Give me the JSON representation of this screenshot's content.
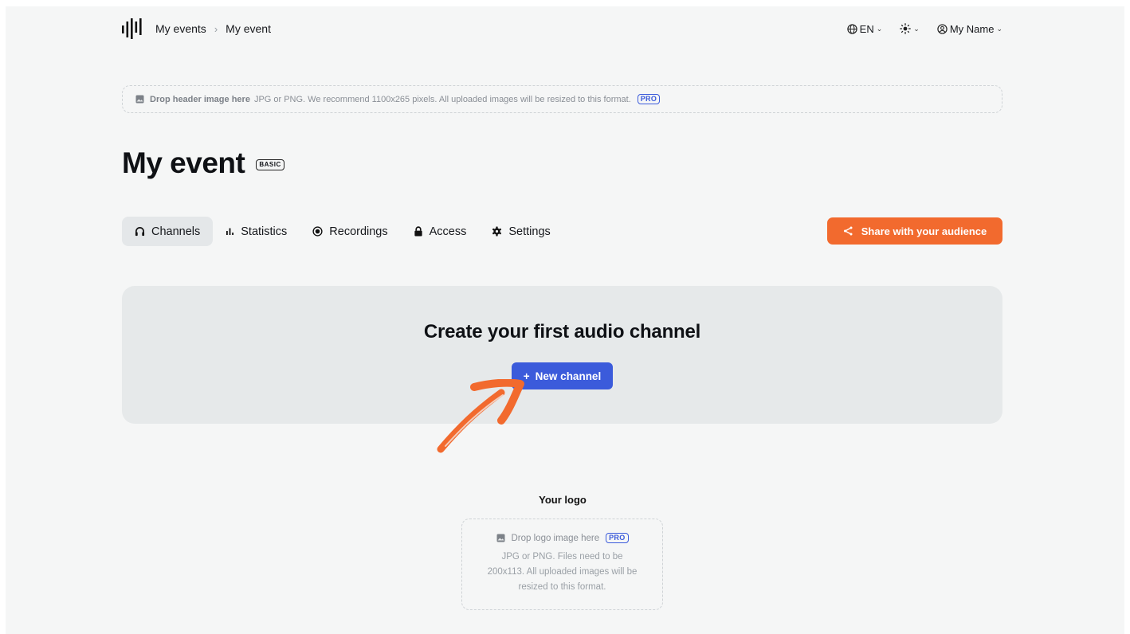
{
  "breadcrumb": {
    "home": "My events",
    "separator": "›",
    "current": "My event"
  },
  "topbar": {
    "language": "EN",
    "user": "My Name"
  },
  "header_drop": {
    "strong": "Drop header image here",
    "hint": "JPG or PNG. We recommend 1100x265 pixels. All uploaded images will be resized to this format.",
    "badge": "PRO"
  },
  "page": {
    "title": "My event",
    "badge": "BASIC"
  },
  "tabs": [
    {
      "label": "Channels",
      "icon": "headphones-icon",
      "active": true
    },
    {
      "label": "Statistics",
      "icon": "bar-chart-icon",
      "active": false
    },
    {
      "label": "Recordings",
      "icon": "record-icon",
      "active": false
    },
    {
      "label": "Access",
      "icon": "lock-icon",
      "active": false
    },
    {
      "label": "Settings",
      "icon": "gear-icon",
      "active": false
    }
  ],
  "share": {
    "label": "Share with your audience"
  },
  "create_panel": {
    "title": "Create your first audio channel",
    "button_label": "New channel",
    "button_prefix": "+"
  },
  "logo_zone": {
    "label": "Your logo",
    "drop_text": "Drop logo image here",
    "badge": "PRO",
    "description": "JPG or PNG. Files need to be 200x113. All uploaded images will be resized to this format."
  },
  "colors": {
    "accent": "#3b5bdb",
    "share": "#f26a2e",
    "background": "#f5f6f6",
    "panel": "#e6e9ea"
  }
}
